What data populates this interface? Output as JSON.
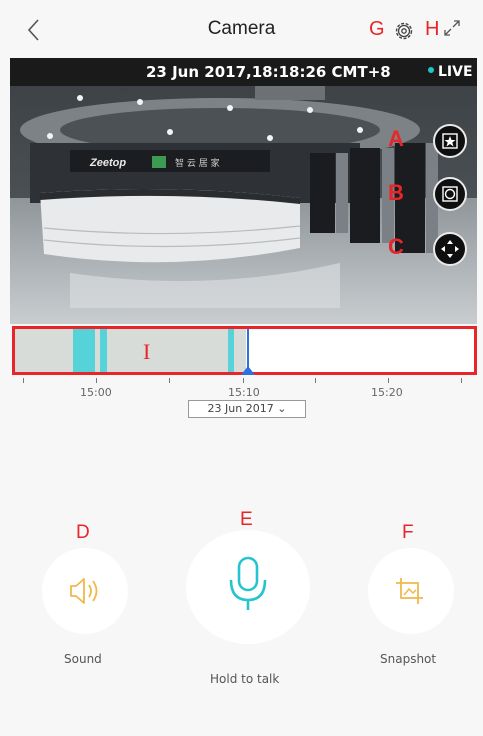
{
  "header": {
    "title": "Camera",
    "label_g": "G",
    "label_h": "H"
  },
  "video": {
    "timestamp": "23 Jun 2017,18:18:26 CMT+8",
    "live": "LIVE",
    "label_a": "A",
    "label_b": "B",
    "label_c": "C"
  },
  "timeline": {
    "label_i": "I",
    "ticks": [
      "15:00",
      "15:10",
      "15:20"
    ],
    "date": "23 Jun 2017"
  },
  "controls": {
    "label_d": "D",
    "label_e": "E",
    "label_f": "F",
    "sound": "Sound",
    "talk": "Hold to talk",
    "snapshot": "Snapshot"
  }
}
